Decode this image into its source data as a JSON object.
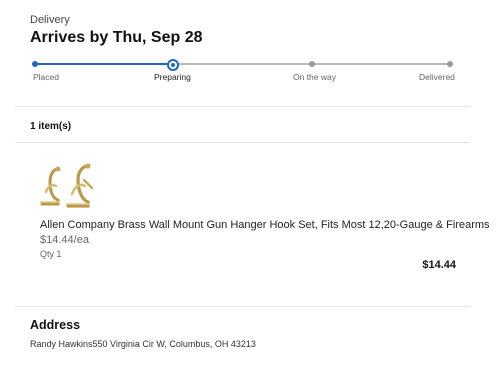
{
  "delivery": {
    "label": "Delivery",
    "arrives": "Arrives by Thu, Sep 28"
  },
  "tracker": {
    "steps": [
      {
        "label": "Placed",
        "state": "done"
      },
      {
        "label": "Preparing",
        "state": "current"
      },
      {
        "label": "On the way",
        "state": "pending"
      },
      {
        "label": "Delivered",
        "state": "pending"
      }
    ],
    "active_color": "#1f66c8",
    "inactive_color": "#9a9a9a"
  },
  "items": {
    "count_label": "1 item(s)",
    "list": [
      {
        "image_icon": "brass-gun-hanger-hooks",
        "name": "Allen Company Brass Wall Mount Gun Hanger Hook Set, Fits Most 12,20-Gauge & Firearms",
        "unit_price": "$14.44/ea",
        "qty": "Qty 1",
        "total": "$14.44"
      }
    ]
  },
  "address": {
    "heading": "Address",
    "line": "Randy Hawkins550 Virginia Cir W, Columbus, OH 43213"
  }
}
